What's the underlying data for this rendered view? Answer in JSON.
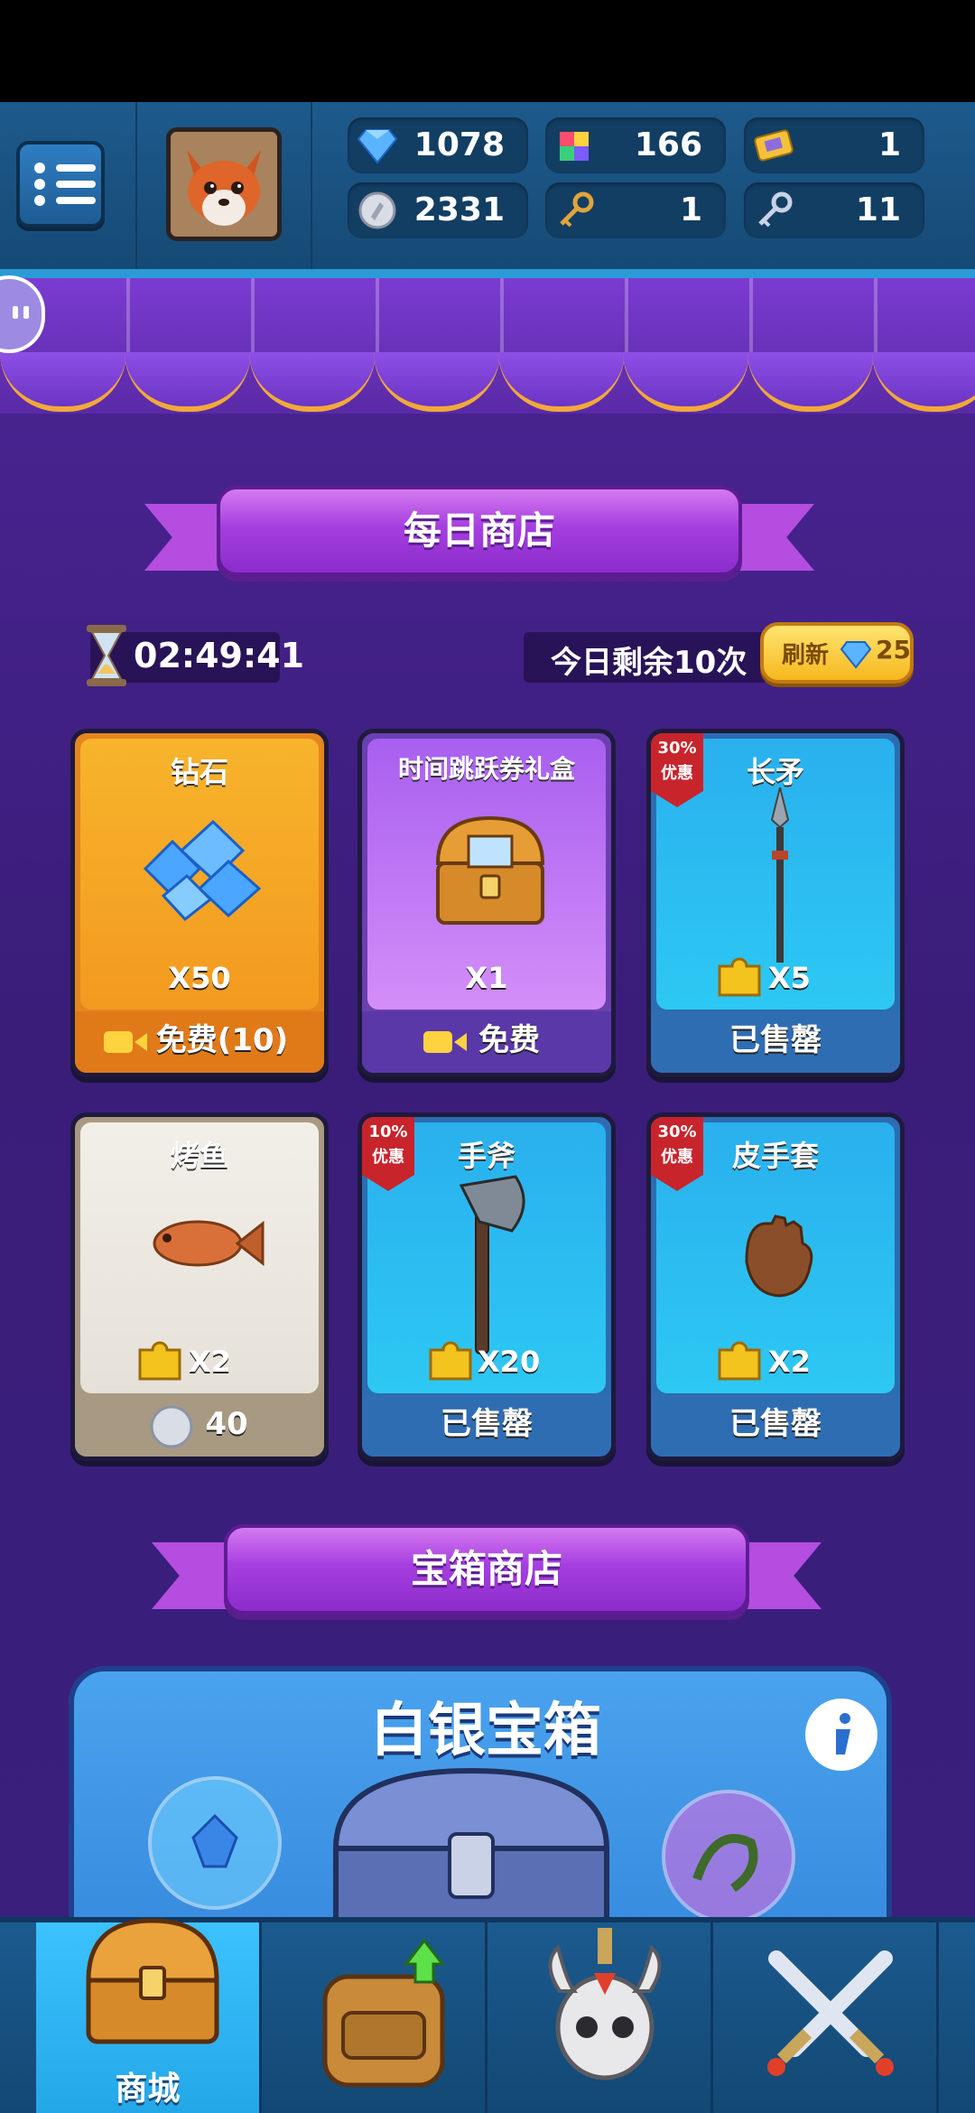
{
  "resources": {
    "diamonds": "1078",
    "puzzle": "166",
    "ticket": "1",
    "silver": "2331",
    "gold_key": "1",
    "silver_key": "11"
  },
  "daily_shop": {
    "title": "每日商店",
    "timer": "02:49:41",
    "remaining": "今日剩余10次",
    "refresh_label": "刷新",
    "refresh_cost": "25",
    "items": [
      {
        "title": "钻石",
        "qty": "X50",
        "footer": "免费(10)",
        "badge": null
      },
      {
        "title": "时间跳跃券礼盒",
        "qty": "X1",
        "footer": "免费",
        "badge": null
      },
      {
        "title": "长矛",
        "qty": "X5",
        "footer": "已售罄",
        "badge": [
          "30%",
          "优惠"
        ]
      },
      {
        "title": "烤鱼",
        "qty": "X2",
        "footer": "40",
        "badge": null
      },
      {
        "title": "手斧",
        "qty": "X20",
        "footer": "已售罄",
        "badge": [
          "10%",
          "优惠"
        ]
      },
      {
        "title": "皮手套",
        "qty": "X2",
        "footer": "已售罄",
        "badge": [
          "30%",
          "优惠"
        ]
      }
    ]
  },
  "chest_shop": {
    "title": "宝箱商店",
    "chest_name": "白银宝箱"
  },
  "bottom_nav": {
    "shop_label": "商城"
  },
  "colors": {
    "header_bg": "#1d5a8c",
    "main_bg": "#47238f",
    "sold_out_footer": "#2f6db3",
    "gold_card": "#f5a623",
    "purple_card": "#c47df0"
  }
}
